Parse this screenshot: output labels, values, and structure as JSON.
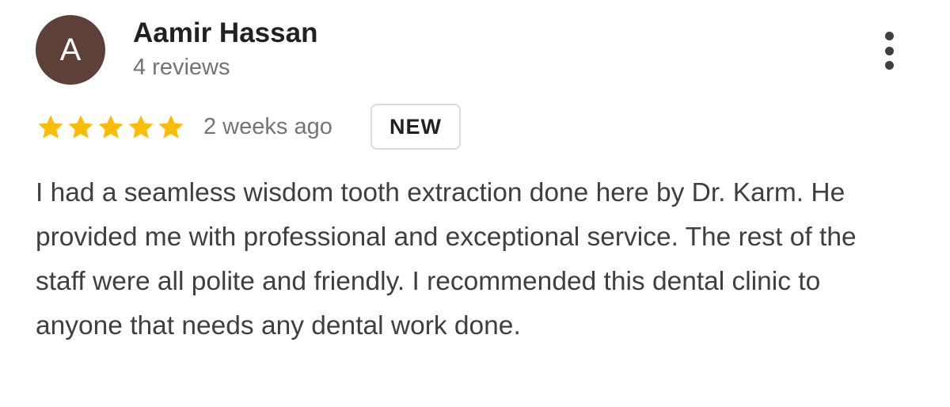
{
  "review": {
    "author": {
      "initial": "A",
      "name": "Aamir Hassan",
      "review_count": "4 reviews",
      "avatar_color": "#5d4037"
    },
    "rating": {
      "stars": 5,
      "max_stars": 5,
      "star_color": "#fbbc04"
    },
    "date": "2 weeks ago",
    "badge": "NEW",
    "text": "I had a seamless wisdom tooth extraction done here by Dr. Karm. He provided me with professional and exceptional service. The rest of the staff were all polite and friendly. I recommended this dental clinic to anyone that needs any dental work done."
  },
  "icons": {
    "menu": "more-vert-icon",
    "rating": "star-icon"
  }
}
